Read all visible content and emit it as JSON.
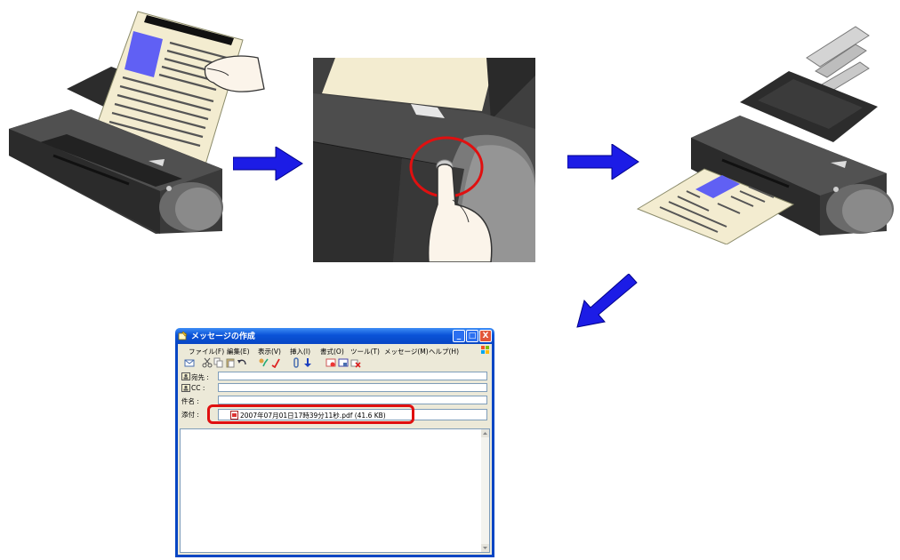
{
  "window": {
    "title": "メッセージの作成",
    "buttons": [
      "_",
      "□",
      "X"
    ]
  },
  "menu": [
    "ファイル(F)",
    "編集(E)",
    "表示(V)",
    "挿入(I)",
    "書式(O)",
    "ツール(T)",
    "メッセージ(M)",
    "ヘルプ(H)"
  ],
  "fields": {
    "to_label": "宛先 :",
    "cc_label": "CC :",
    "subject_label": "件名 :",
    "attach_label": "添付 :",
    "to_value": "",
    "cc_value": "",
    "subject_value": "",
    "attachment": "2007年07月01日17時39分11秒.pdf (41.6 KB)"
  },
  "icons": {
    "toolbar": [
      "send-icon",
      "cut-icon",
      "copy-icon",
      "paste-icon",
      "undo-icon",
      "check-names-icon",
      "spelling-icon",
      "attach-icon",
      "priority-icon",
      "sign-icon",
      "encrypt-icon",
      "offline-icon"
    ],
    "steps": [
      "scanner-with-document",
      "press-scan-button",
      "scanner-outputs-document"
    ],
    "arrows": [
      "arrow-right",
      "arrow-right",
      "arrow-down-left"
    ]
  },
  "colors": {
    "arrow": "#1c1ce6",
    "highlight": "#e01010",
    "paper": "#f3ecd0",
    "picture": "#6060f4",
    "scanner_body": "#3a3a3a",
    "titlebar": "#0a53d8"
  }
}
